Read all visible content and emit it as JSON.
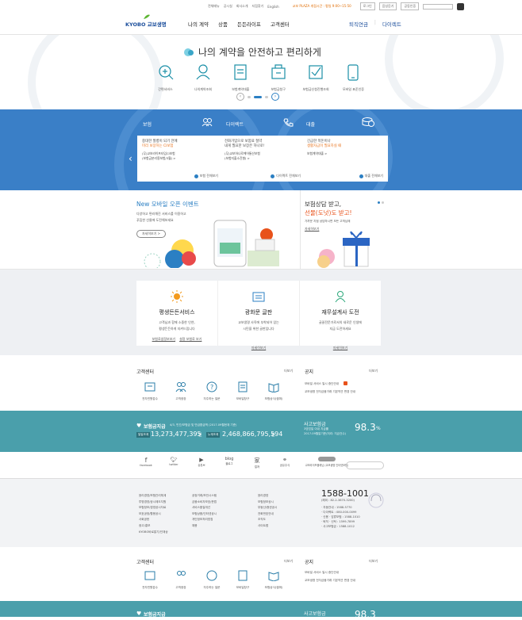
{
  "util": {
    "links": [
      "전체메뉴",
      "공시실",
      "회사소개",
      "지점찾기",
      "English"
    ],
    "plaza": "교보 PLAZA 개점시간 : 평일 9:00~15:50",
    "login": "로그인",
    "listen": "음성듣기",
    "cert": "공동인증"
  },
  "header": {
    "logo": "KYOBO 교보생명",
    "nav": [
      "나의 계약",
      "상품",
      "든든라이프",
      "고객센터"
    ],
    "right": [
      "퇴직연금",
      "다이렉트"
    ]
  },
  "hero": {
    "title": "나의 계약을 안전하고 편리하게",
    "items": [
      "간편서비스",
      "나의계약조회",
      "보험계약대출",
      "보험금청구",
      "보험금신청진행조회",
      "모바일 표준인증"
    ]
  },
  "products": {
    "cols": [
      {
        "title": "보험",
        "lines": [
          "중대한 질병이 되기 전에",
          "미리 보장하는 CI보험",
          "(무)교보라이프타임CI보험",
          "(보험금분리용보험/3월) >"
        ],
        "more": "보험 전체보기"
      },
      {
        "title": "다이렉트",
        "lines": [
          "전화가입으로 보험료 절약",
          "내게 필요한 보장은 하나로!",
          "(무)교보하나로케어통산보험",
          "(보험지출소진형) >"
        ],
        "more": "다이렉트 전체보기"
      },
      {
        "title": "대출",
        "lines": [
          "긴급한 목돈이나",
          "생활자금이 필요하실 때",
          "보험계약대출 >"
        ],
        "more": "대출 전체보기"
      }
    ]
  },
  "event": {
    "title": "New 모바일 오픈 이벤트",
    "desc1": "다양하고 편리해진 서비스를 이용하고",
    "desc2": "푸짐한 선물에 도전해보세요",
    "btn": "자세히보기 >"
  },
  "promo": {
    "line1": "보험상담 받고,",
    "line2": "선물(도넛)도 받고!",
    "desc": "가까운 지점 상담하시면 모든 고객님께",
    "link": "자세히보기"
  },
  "services": [
    {
      "title": "평생든든서비스",
      "d1": "고객님과 함께 소중한 인연,",
      "d2": "평생든든하게 지켜드립니다",
      "l1": "보험료셈정보보기",
      "l2": "설정 보험료 보기"
    },
    {
      "title": "광화문 글판",
      "d1": "교보생명 사옥에 부착되어 있는",
      "d2": "시민을 위한 글판입니다",
      "l1": "자세히보기",
      "l2": ""
    },
    {
      "title": "재무설계사 도전",
      "d1": "글꼴전문가로서의 새로운 인생에",
      "d2": "지금 도전하세요",
      "l1": "자세히보기",
      "l2": ""
    }
  ],
  "cs": {
    "title": "고객센터",
    "more": "더보기",
    "items": [
      "전자민원접수",
      "고객광장",
      "자주하는 질문",
      "모바일창구",
      "보험상식(캠퍼)"
    ]
  },
  "notice": {
    "title": "공지",
    "more": "더보기",
    "items": [
      "모바일 서비스 일시 중단안내",
      "교보생명 전자금융거래 기본약관 변경 안내"
    ]
  },
  "payout": {
    "label": "보험금지급",
    "sub": "4/3, 민간/보험금 및 만급환급액 (2017.09월현재 기준)",
    "b1": "일일조계",
    "v1": "13,273,477,395",
    "u1": "원",
    "b2": "누계조계",
    "v2": "2,468,866,795,594",
    "u2": "원",
    "rlabel": "사고보험금",
    "rsub1": "3영업일 이내 지급률",
    "rsub2": "2017.09월말기준(처리: 지급건수)",
    "rate": "98.3",
    "unit": "%"
  },
  "social": [
    "facebook",
    "twitter",
    "유튜브",
    "블로그",
    "컬쳐",
    "공유주식",
    "교보라이프플래닛 (교보생명 인터넷보험)"
  ],
  "foot": {
    "c1": [
      "윤리경영/보험관리체계",
      "투명경영/공시제도지원",
      "보험정보/경영공시자료",
      "보호공정/활용공시",
      "사회공헌",
      "광고/홍보",
      "KYOBO바로알기/인재상"
    ],
    "c2": [
      "공정거래/보안시스템",
      "금융소비자보호/준법",
      "서비스품질개선",
      "보험상품/인터넷공시",
      "개인정보처리방침",
      "채용",
      "교보생명/교육포털"
    ],
    "c3": [
      "윤리경영",
      "보험정보공시",
      "부동산/증권공시",
      "전화번호안내",
      "조직도",
      "사이트맵"
    ],
    "phone": "1588-1001",
    "p1": "(해외 : 82-2-3670-3200)",
    "p2": [
      "· 자동안내 : 1588-5770",
      "· 다이렉트 : 080-000-0099",
      "· 신용 · 압류보험 : 1588-1010",
      "· 퇴직 · 신탁 : 1599-7899",
      "· 사고보험금 : 1588-1012"
    ]
  },
  "colors": {
    "brand": "#3a7fc7",
    "teal": "#4a9fab",
    "green": "#2a9d3a",
    "orange": "#e8721b"
  }
}
